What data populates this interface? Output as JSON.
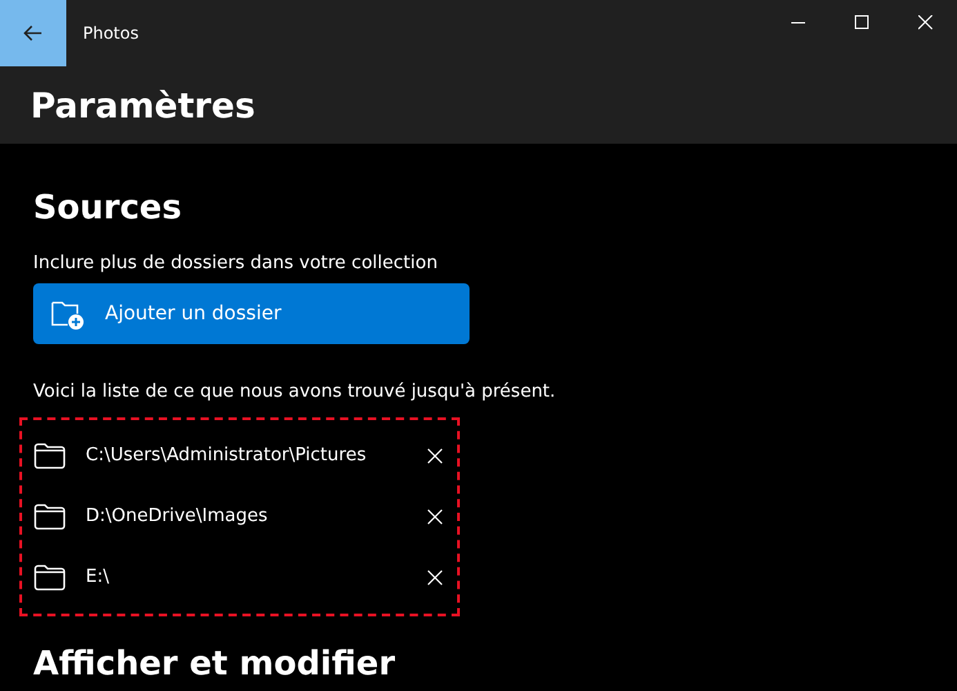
{
  "window": {
    "title": "Photos"
  },
  "header": {
    "title": "Paramètres"
  },
  "sources": {
    "heading": "Sources",
    "description": "Inclure plus de dossiers dans votre collection",
    "add_button": "Ajouter un dossier",
    "list_caption": "Voici la liste de ce que nous avons trouvé jusqu'à présent.",
    "highlighted": true,
    "folders": [
      {
        "path": "C:\\Users\\Administrator\\Pictures"
      },
      {
        "path": "D:\\OneDrive\\Images"
      },
      {
        "path": "E:\\"
      }
    ]
  },
  "next_section": {
    "heading": "Afficher et modifier"
  }
}
